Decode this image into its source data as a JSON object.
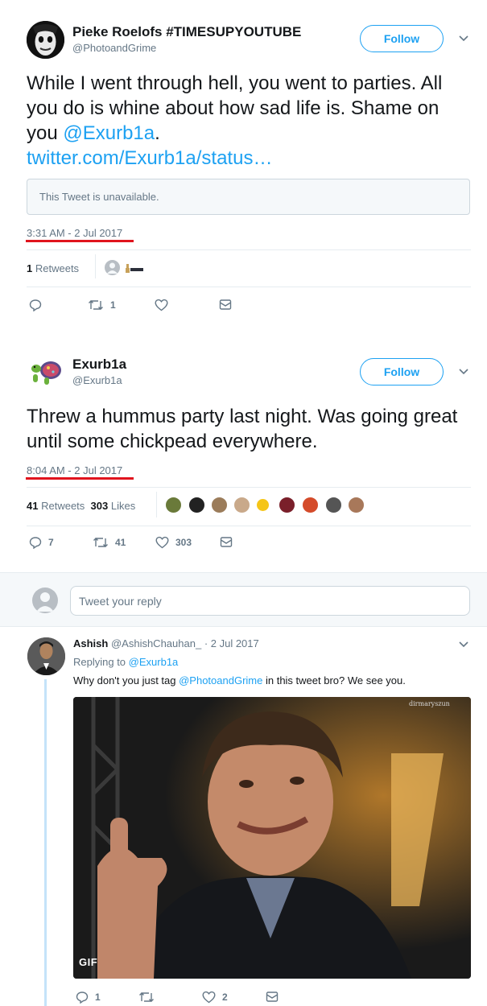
{
  "tweet1": {
    "name": "Pieke Roelofs #TIMESUPYOUTUBE",
    "handle": "@PhotoandGrime",
    "follow_label": "Follow",
    "text_before": "While I went through hell, you went to parties. All you do is whine about how sad life is. Shame on you ",
    "mention": "@Exurb1a",
    "text_after": ".",
    "link": "twitter.com/Exurb1a/status…",
    "unavailable_text": "This Tweet is unavailable.",
    "timestamp": "3:31 AM - 2 Jul 2017",
    "retweet_count": "1",
    "retweet_label": "Retweets",
    "actions": {
      "reply": "",
      "retweet": "1",
      "like": ""
    }
  },
  "tweet2": {
    "name": "Exurb1a",
    "handle": "@Exurb1a",
    "follow_label": "Follow",
    "text": "Threw a hummus party last night. Was going great until some chickpead everywhere.",
    "timestamp": "8:04 AM - 2 Jul 2017",
    "retweet_count": "41",
    "retweet_label": "Retweets",
    "like_count": "303",
    "like_label": "Likes",
    "actions": {
      "reply": "7",
      "retweet": "41",
      "like": "303"
    }
  },
  "reply_box": {
    "placeholder": "Tweet your reply"
  },
  "reply": {
    "name": "Ashish",
    "handle": "@AshishChauhan_",
    "date": "· 2 Jul 2017",
    "replying_prefix": "Replying to ",
    "replying_to": "@Exurb1a",
    "text_before": "Why don't you just tag ",
    "mention": "@PhotoandGrime",
    "text_after": " in this tweet bro? We see you.",
    "gif_label": "GIF",
    "gif_watermark": "dirmaryszun",
    "actions": {
      "reply": "1",
      "retweet": "",
      "like": "2"
    }
  },
  "colors": {
    "accent": "#1da1f2",
    "highlight": "#e0141e",
    "muted": "#657786"
  }
}
